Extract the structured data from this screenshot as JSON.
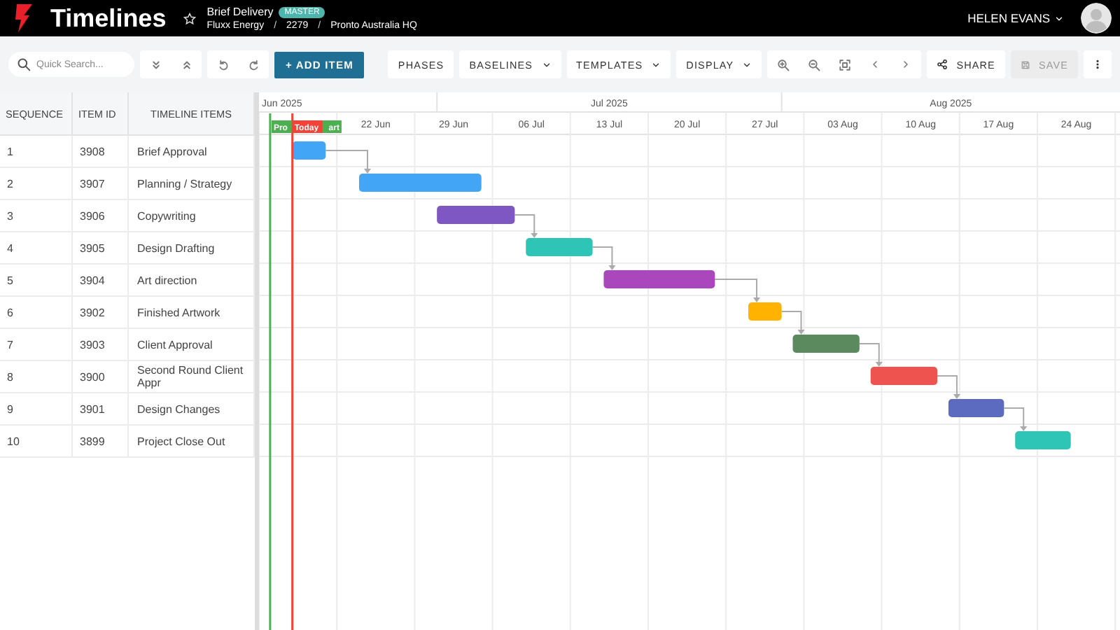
{
  "header": {
    "app_title": "Timelines",
    "project": {
      "name": "Brief Delivery",
      "badge": "MASTER",
      "starred": false
    },
    "breadcrumb": [
      {
        "kind": "link",
        "text": "Fluxx Energy"
      },
      {
        "kind": "separator",
        "text": "/"
      },
      {
        "kind": "link",
        "text": "2279"
      },
      {
        "kind": "separator",
        "text": "/"
      },
      {
        "kind": "link",
        "text": "Pronto Australia HQ"
      }
    ],
    "user": "HELEN EVANS"
  },
  "toolbar": {
    "search": {
      "placeholder": "Quick Search..."
    },
    "add_button": "+ ADD ITEM",
    "menus": [
      {
        "label": "PHASES",
        "kind": "plain"
      },
      {
        "label": "BASELINES",
        "kind": "dropdown"
      },
      {
        "label": "TEMPLATES",
        "kind": "dropdown"
      },
      {
        "label": "DISPLAY",
        "kind": "dropdown"
      }
    ],
    "share": {
      "label": "SHARE"
    },
    "save": {
      "label": "SAVE",
      "disabled": true
    }
  },
  "table": {
    "columns": [
      "SEQUENCE",
      "ITEM ID",
      "TIMELINE ITEMS"
    ],
    "rows": [
      {
        "sequence": "1",
        "item_id": "3908",
        "name": "Brief Approval",
        "color": "#42a5f5"
      },
      {
        "sequence": "2",
        "item_id": "3907",
        "name": "Planning / Strategy",
        "color": "#42a5f5"
      },
      {
        "sequence": "3",
        "item_id": "3906",
        "name": "Copywriting",
        "color": "#7e57c2"
      },
      {
        "sequence": "4",
        "item_id": "3905",
        "name": "Design Drafting",
        "color": "#2ec4b6"
      },
      {
        "sequence": "5",
        "item_id": "3904",
        "name": "Art direction",
        "color": "#ab47bc"
      },
      {
        "sequence": "6",
        "item_id": "3902",
        "name": "Finished Artwork",
        "color": "#ffb300"
      },
      {
        "sequence": "7",
        "item_id": "3903",
        "name": "Client Approval",
        "color": "#5b8a5e"
      },
      {
        "sequence": "8",
        "item_id": "3900",
        "name": "Second Round Client Appr",
        "color": "#ef5350"
      },
      {
        "sequence": "9",
        "item_id": "3901",
        "name": "Design Changes",
        "color": "#5c6bc0"
      },
      {
        "sequence": "10",
        "item_id": "3899",
        "name": "Project Close Out",
        "color": "#2ec4b6"
      }
    ]
  },
  "timeline": {
    "months": [
      "Jun 2025",
      "Jul 2025",
      "Aug 2025"
    ],
    "weeks": [
      "22 Jun",
      "29 Jun",
      "06 Jul",
      "13 Jul",
      "20 Jul",
      "27 Jul",
      "03 Aug",
      "10 Aug",
      "17 Aug",
      "24 Aug"
    ],
    "markers": [
      {
        "label_parts": [
          "Pro",
          "art"
        ],
        "color": "#4caf50"
      },
      {
        "label_parts": [
          "Today"
        ],
        "color": "#f44336"
      }
    ]
  }
}
